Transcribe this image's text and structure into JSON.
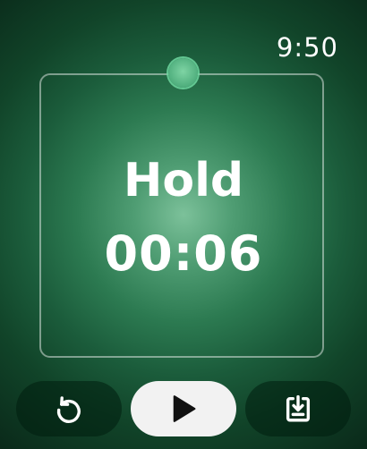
{
  "status_bar": {
    "time": "9:50"
  },
  "exercise": {
    "phase": "Hold",
    "remaining": "00:06"
  },
  "controls": {
    "reset_icon": "restart-icon",
    "play_icon": "play-icon",
    "save_icon": "save-download-icon"
  },
  "colors": {
    "accent": "#4fae7d",
    "background": "#0a2a1a",
    "play_button": "#f2f2f2"
  }
}
